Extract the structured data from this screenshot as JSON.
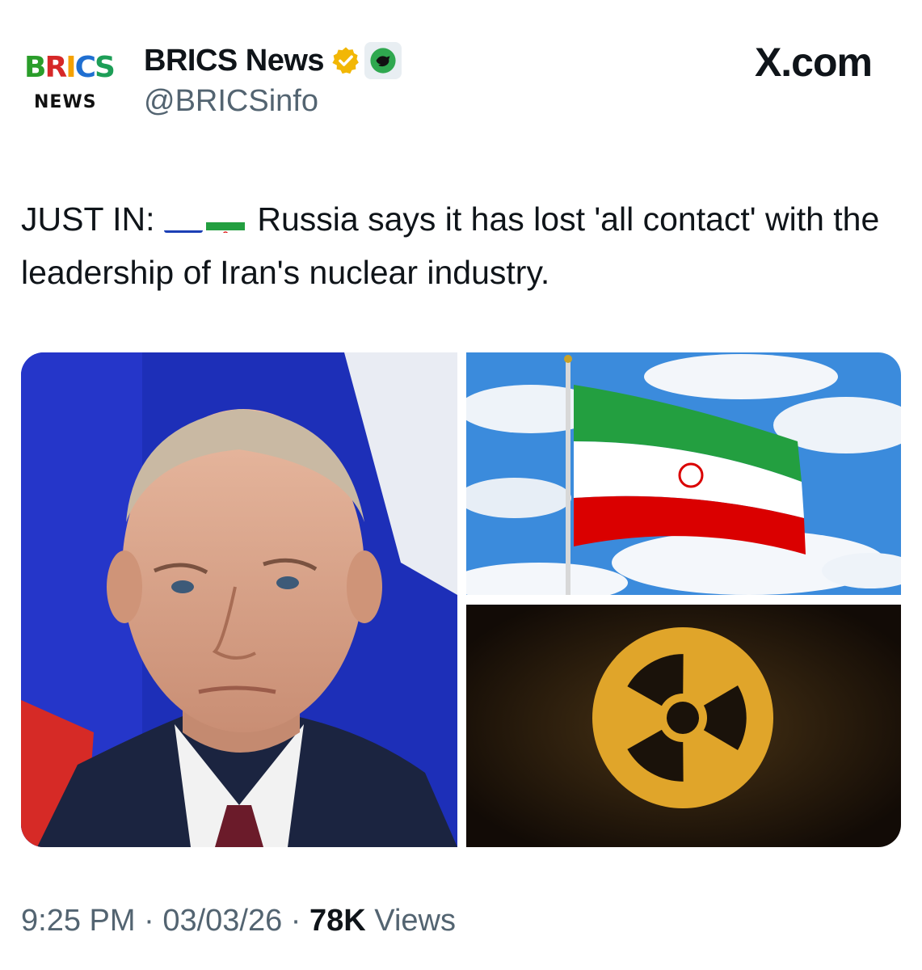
{
  "logo": {
    "word": "BRICS",
    "sub": "NEWS"
  },
  "author": {
    "display_name": "BRICS News",
    "handle": "@BRICSinfo",
    "verified_icon": "gold-verified-badge",
    "affiliate_icon": "affiliate-badge"
  },
  "site": "X.com",
  "tweet": {
    "prefix": "JUST IN:",
    "flags": [
      "russia-flag",
      "iran-flag"
    ],
    "body": "Russia says it has lost 'all contact' with the leadership of Iran's nuclear industry."
  },
  "media": [
    "portrait-photo",
    "iran-flag-photo",
    "radiation-symbol-photo"
  ],
  "meta": {
    "time": "9:25 PM",
    "sep1": " · ",
    "date": "03/03/26",
    "sep2": " · ",
    "views_count": "78K",
    "views_label": " Views"
  },
  "colors": {
    "text": "#0f1419",
    "muted": "#536471",
    "verified": "#f2b705"
  }
}
